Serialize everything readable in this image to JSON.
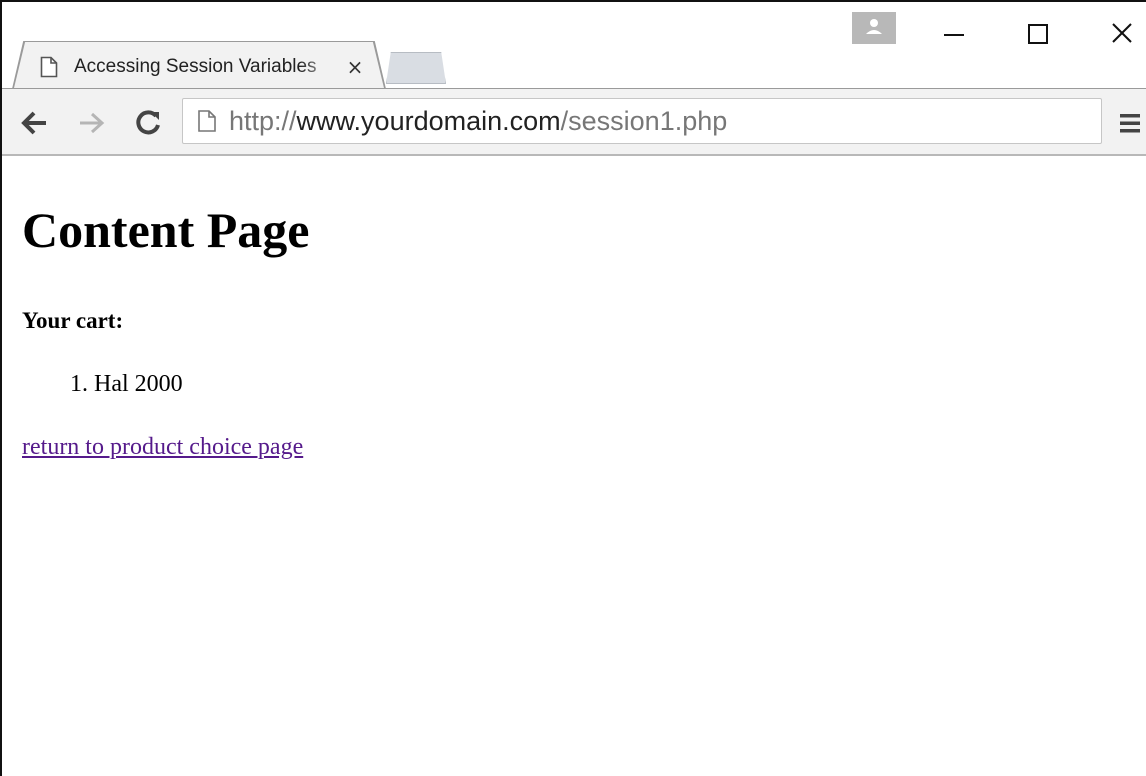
{
  "browser": {
    "tab": {
      "title": "Accessing Session Variables",
      "close_glyph": "×",
      "icon": "page-icon"
    },
    "window_controls": {
      "minimize_icon": "minimize-icon",
      "maximize_icon": "maximize-icon",
      "close_icon": "close-icon",
      "profile_icon": "person-icon"
    },
    "toolbar": {
      "back_icon": "back-arrow-icon",
      "forward_icon": "forward-arrow-icon",
      "reload_icon": "reload-icon",
      "menu_icon": "hamburger-menu-icon"
    },
    "address_bar": {
      "scheme": "http://",
      "host": "www.yourdomain.com",
      "path": "/session1.php"
    }
  },
  "page": {
    "title": "Content Page",
    "cart_heading": "Your cart:",
    "cart_items": [
      "Hal 2000"
    ],
    "return_link": "return to product choice page"
  },
  "colors": {
    "link_visited": "#551a8b",
    "toolbar_bg": "#f2f2f2"
  }
}
